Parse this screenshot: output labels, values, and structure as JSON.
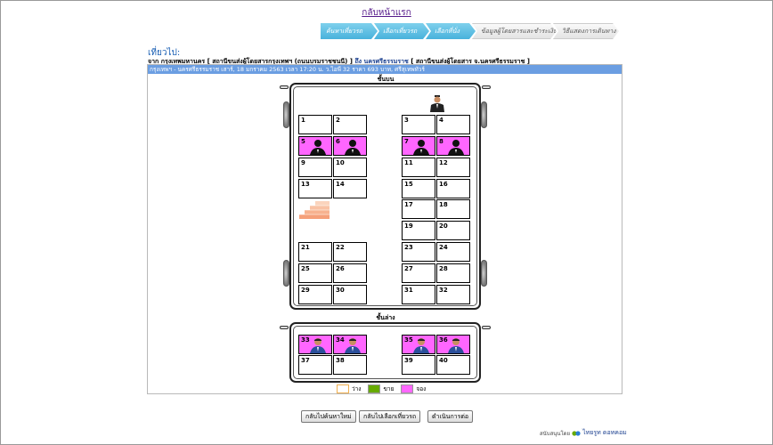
{
  "header": {
    "home_link": "กลับหน้าแรก",
    "steps": [
      {
        "label": "ค้นหาเที่ยวรถ",
        "active": true
      },
      {
        "label": "เลือกเที่ยวรถ",
        "active": true
      },
      {
        "label": "เลือกที่นั่ง",
        "active": true
      },
      {
        "label": "ข้อมูลผู้โดยสารและชำระเงิน",
        "active": false
      },
      {
        "label": "วิธีแสดงการเดินทาง",
        "active": false
      }
    ]
  },
  "trip": {
    "section_label": "เที่ยวไป:",
    "route_prefix": "จาก กรุงเทพมหานคร [ สถานีขนส่งผู้โดยสารกรุงเทพฯ (ถนนบรมราชชนนี) ]",
    "route_to": "ถึง นครศรีธรรมราช",
    "route_suffix": "[ สถานีขนส่งผู้โดยสาร จ.นครศรีธรรมราช ]",
    "trip_bar": "กรุงเทพฯ - นครศรีธรรมราช  เสาร์, 18 มกราคม 2563 เวลา 17:20 น. ว.ไอพี 32 ราคา 693 บาท, ศรีสุเทพทัวร์"
  },
  "upper_deck": {
    "label": "ชั้นบน",
    "seats": [
      {
        "num": "1",
        "status": "available"
      },
      {
        "num": "2",
        "status": "available"
      },
      {
        "num": "3",
        "status": "available"
      },
      {
        "num": "4",
        "status": "available"
      },
      {
        "num": "5",
        "status": "booked"
      },
      {
        "num": "6",
        "status": "booked"
      },
      {
        "num": "7",
        "status": "booked"
      },
      {
        "num": "8",
        "status": "booked"
      },
      {
        "num": "9",
        "status": "available"
      },
      {
        "num": "10",
        "status": "available"
      },
      {
        "num": "11",
        "status": "available"
      },
      {
        "num": "12",
        "status": "available"
      },
      {
        "num": "13",
        "status": "available"
      },
      {
        "num": "14",
        "status": "available"
      },
      {
        "num": "15",
        "status": "available"
      },
      {
        "num": "16",
        "status": "available"
      },
      {
        "num": "17",
        "status": "available"
      },
      {
        "num": "18",
        "status": "available"
      },
      {
        "num": "19",
        "status": "available"
      },
      {
        "num": "20",
        "status": "available"
      },
      {
        "num": "21",
        "status": "available"
      },
      {
        "num": "22",
        "status": "available"
      },
      {
        "num": "23",
        "status": "available"
      },
      {
        "num": "24",
        "status": "available"
      },
      {
        "num": "25",
        "status": "available"
      },
      {
        "num": "26",
        "status": "available"
      },
      {
        "num": "27",
        "status": "available"
      },
      {
        "num": "28",
        "status": "available"
      },
      {
        "num": "29",
        "status": "available"
      },
      {
        "num": "30",
        "status": "available"
      },
      {
        "num": "31",
        "status": "available"
      },
      {
        "num": "32",
        "status": "available"
      }
    ]
  },
  "lower_deck": {
    "label": "ชั้นล่าง",
    "seats": [
      {
        "num": "33",
        "status": "booked"
      },
      {
        "num": "34",
        "status": "booked"
      },
      {
        "num": "35",
        "status": "booked"
      },
      {
        "num": "36",
        "status": "booked"
      },
      {
        "num": "37",
        "status": "available"
      },
      {
        "num": "38",
        "status": "available"
      },
      {
        "num": "39",
        "status": "available"
      },
      {
        "num": "40",
        "status": "available"
      }
    ]
  },
  "legend": {
    "available": "ว่าง",
    "sold": "ขาย",
    "reserved": "จอง"
  },
  "colors": {
    "available": "#ffffff",
    "sold": "#66aa00",
    "reserved": "#ff66ff",
    "available_border": "#f0b050",
    "active_step": "#48b2dc",
    "trip_bar": "#6b9ee2"
  },
  "buttons": {
    "search_again": "กลับไปค้นหาใหม่",
    "back_select": "กลับไปเลือกเที่ยวรถ",
    "continue": "ดำเนินการต่อ"
  },
  "footer": {
    "prefix": "สนับสนุนโดย",
    "brand": "ไทยรูท ดอทคอม"
  }
}
